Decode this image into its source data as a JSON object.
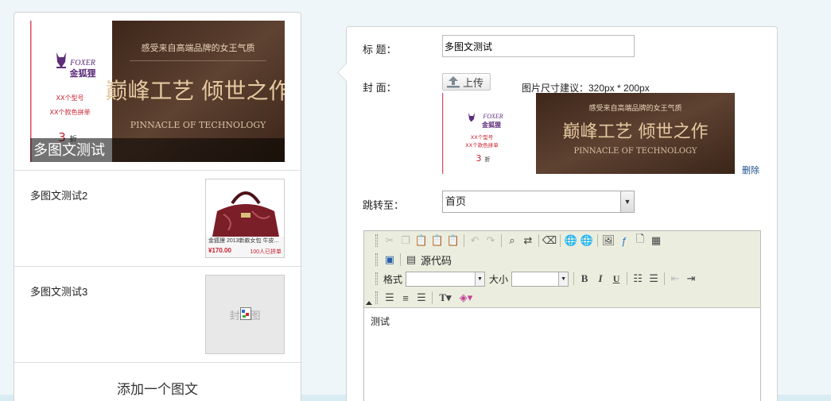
{
  "list": {
    "main_title": "多图文测试",
    "items": [
      {
        "title": "多图文测试2"
      },
      {
        "title": "多图文测试3",
        "thumb_placeholder": "封面图"
      }
    ],
    "add_label": "添加一个图文"
  },
  "banner": {
    "brand_en": "FOXER",
    "brand_cn": "金狐狸",
    "line1": "XX个型号",
    "line2": "XX个款色拼单",
    "discount": "3",
    "discount_unit": "折",
    "tagline": "感受来自高端品牌的女王气质",
    "headline": "巅峰工艺 倾世之作",
    "subline": "PINNACLE OF TECHNOLOGY"
  },
  "bag_thumb": {
    "caption": "金狐狸 2013新款女包 牛皮...",
    "price": "¥170.00",
    "sold": "100人已拼单"
  },
  "editor": {
    "title_label": "标 题：",
    "title_value": "多图文测试",
    "cover_label": "封 面：",
    "upload_label": "上传",
    "size_hint": "图片尺寸建议：320px * 200px",
    "delete_label": "删除",
    "jump_label": "跳转至：",
    "jump_value": "首页",
    "source_label": "源代码",
    "format_label": "格式",
    "size_label": "大小",
    "content": "测试"
  },
  "colors": {
    "banner_brown": "#4a3224",
    "toolbar_bg": "#ebeede",
    "link_blue": "#1a4f8a"
  }
}
